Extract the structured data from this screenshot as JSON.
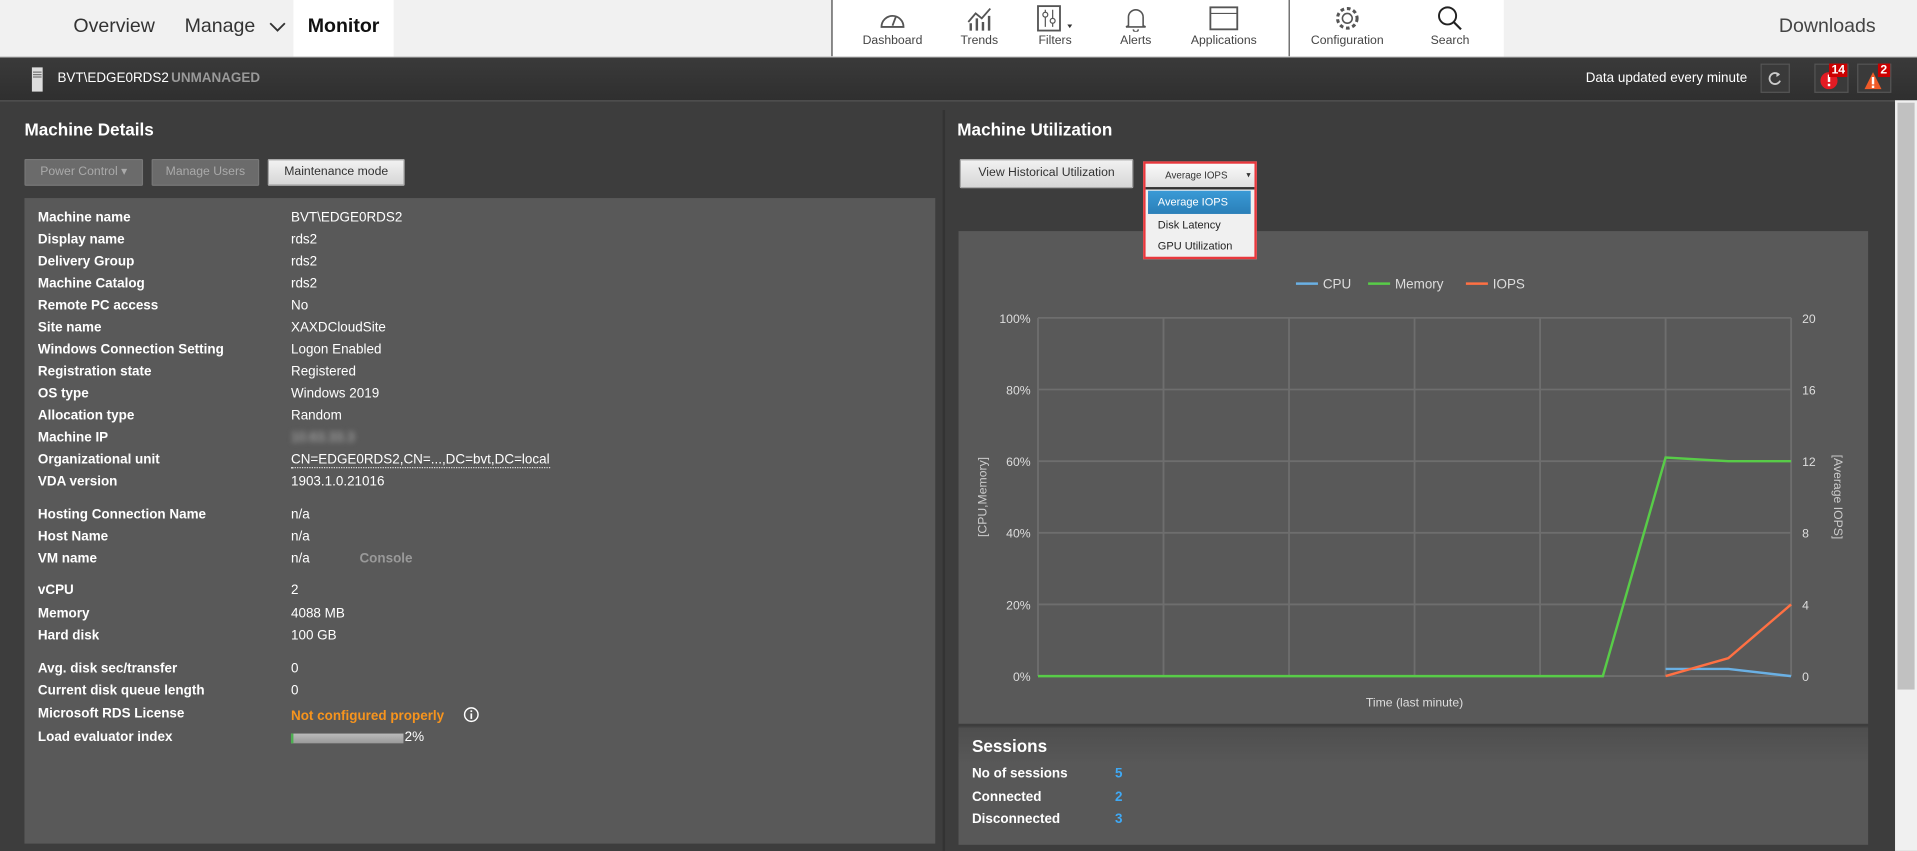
{
  "nav": {
    "overview": "Overview",
    "manage": "Manage",
    "monitor": "Monitor",
    "downloads": "Downloads",
    "tools": [
      {
        "label": "Dashboard",
        "icon": "dashboard-icon"
      },
      {
        "label": "Trends",
        "icon": "trends-icon"
      },
      {
        "label": "Filters",
        "icon": "filters-icon"
      },
      {
        "label": "Alerts",
        "icon": "bell-icon"
      },
      {
        "label": "Applications",
        "icon": "window-icon"
      }
    ],
    "tools2": [
      {
        "label": "Configuration",
        "icon": "gear-icon"
      },
      {
        "label": "Search",
        "icon": "search-icon"
      }
    ]
  },
  "header": {
    "machine": "BVT\\EDGE0RDS2",
    "state": "UNMANAGED",
    "updated": "Data updated every minute",
    "critical_count": "14",
    "warning_count": "2"
  },
  "details": {
    "title": "Machine Details",
    "buttons": {
      "power": "Power Control",
      "manage_users": "Manage Users",
      "maintenance": "Maintenance mode"
    },
    "rows": [
      {
        "label": "Machine name",
        "value": "BVT\\EDGE0RDS2"
      },
      {
        "label": "Display name",
        "value": "rds2"
      },
      {
        "label": "Delivery Group",
        "value": "rds2"
      },
      {
        "label": "Machine Catalog",
        "value": "rds2"
      },
      {
        "label": "Remote PC access",
        "value": "No"
      },
      {
        "label": "Site name",
        "value": "XAXDCloudSite"
      },
      {
        "label": "Windows Connection Setting",
        "value": "Logon Enabled"
      },
      {
        "label": "Registration state",
        "value": "Registered"
      },
      {
        "label": "OS type",
        "value": "Windows 2019"
      },
      {
        "label": "Allocation type",
        "value": "Random"
      },
      {
        "label": "Machine IP",
        "value": "10.63.33.3"
      },
      {
        "label": "Organizational unit",
        "value": "CN=EDGE0RDS2,CN=...,DC=bvt,DC=local"
      },
      {
        "label": "VDA version",
        "value": "1903.1.0.21016"
      },
      {
        "label": "Hosting Connection Name",
        "value": "n/a"
      },
      {
        "label": "Host Name",
        "value": "n/a"
      },
      {
        "label": "VM name",
        "value": "n/a"
      },
      {
        "label": "vCPU",
        "value": "2"
      },
      {
        "label": "Memory",
        "value": "4088 MB"
      },
      {
        "label": "Hard disk",
        "value": "100 GB"
      },
      {
        "label": "Avg. disk sec/transfer",
        "value": "0"
      },
      {
        "label": "Current disk queue length",
        "value": "0"
      },
      {
        "label": "Microsoft RDS License",
        "value": "Not configured properly"
      },
      {
        "label": "Load evaluator index",
        "value": "2%"
      }
    ],
    "console": "Console",
    "load_index": 2,
    "warning_color": "#f7941d"
  },
  "utilization": {
    "title": "Machine Utilization",
    "historical_button": "View Historical Utilization",
    "selected": "Average IOPS",
    "options": [
      "Average IOPS",
      "Disk Latency",
      "GPU Utilization"
    ]
  },
  "chart_data": {
    "type": "line",
    "xlabel": "Time (last minute)",
    "ylabel": "[CPU,Memory]",
    "y2label": "[Average IOPS]",
    "ylim": [
      0,
      100
    ],
    "y2lim": [
      0,
      20
    ],
    "yticks": [
      "0%",
      "20%",
      "40%",
      "60%",
      "80%",
      "100%"
    ],
    "y2ticks": [
      "0",
      "4",
      "8",
      "12",
      "16",
      "20"
    ],
    "grid": true,
    "legend": "top-center",
    "x": [
      0,
      1,
      2,
      3,
      4,
      5,
      6,
      7,
      8,
      9,
      10,
      11,
      12
    ],
    "series": [
      {
        "name": "CPU",
        "axis": "left",
        "color": "#6ab0e4",
        "values": [
          null,
          null,
          null,
          null,
          null,
          null,
          null,
          null,
          null,
          null,
          2,
          2,
          0
        ]
      },
      {
        "name": "Memory",
        "axis": "left",
        "color": "#58cc48",
        "values": [
          0,
          0,
          0,
          0,
          0,
          0,
          0,
          0,
          0,
          0,
          61,
          60,
          60
        ]
      },
      {
        "name": "IOPS",
        "axis": "right",
        "color": "#ff7043",
        "values": [
          null,
          null,
          null,
          null,
          null,
          null,
          null,
          null,
          null,
          null,
          0,
          1,
          4
        ]
      }
    ]
  },
  "sessions": {
    "title": "Sessions",
    "rows": [
      {
        "label": "No of sessions",
        "value": "5"
      },
      {
        "label": "Connected",
        "value": "2"
      },
      {
        "label": "Disconnected",
        "value": "3"
      }
    ]
  }
}
